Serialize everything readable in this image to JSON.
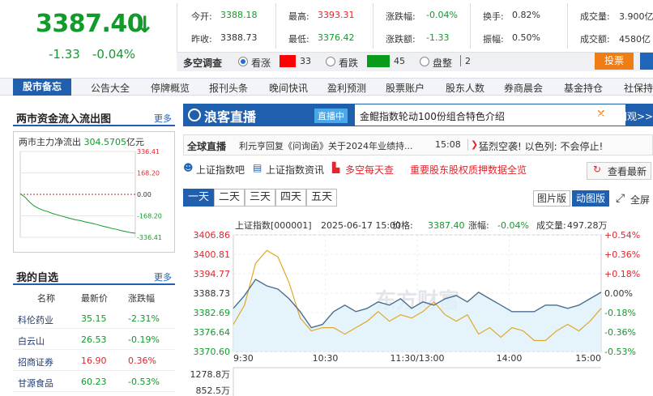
{
  "index_quote": {
    "price": "3387.40",
    "arrow": "↓",
    "change": "-1.33",
    "change_pct": "-0.04%"
  },
  "quote_stats": {
    "row1": [
      {
        "label": "今开:",
        "value": "3388.18",
        "color": "green"
      },
      {
        "label": "最高:",
        "value": "3393.31",
        "color": "red"
      },
      {
        "label": "涨跌幅:",
        "value": "-0.04%",
        "color": "green"
      },
      {
        "label": "换手:",
        "value": "0.82%",
        "color": "normal"
      },
      {
        "label": "成交量:",
        "value": "3.900亿",
        "color": "normal"
      }
    ],
    "row2": [
      {
        "label": "昨收:",
        "value": "3388.73",
        "color": "normal"
      },
      {
        "label": "最低:",
        "value": "3376.42",
        "color": "green"
      },
      {
        "label": "涨跌额:",
        "value": "-1.33",
        "color": "green"
      },
      {
        "label": "振幅:",
        "value": "0.50%",
        "color": "normal"
      },
      {
        "label": "成交额:",
        "value": "4580亿",
        "color": "normal"
      }
    ]
  },
  "poll": {
    "title": "多空调查",
    "bull_label": "看涨",
    "bull_count": "33",
    "bear_label": "看跌",
    "bear_count": "45",
    "flat_label": "盘整",
    "flat_count": "2",
    "vote_label": "投票",
    "colors": {
      "bull": "#ff0000",
      "bear": "#0a9b1a"
    }
  },
  "nav": {
    "first": "股市备忘",
    "items": [
      "公告大全",
      "停牌概览",
      "报刊头条",
      "晚间快讯",
      "盈利预测",
      "股票账户",
      "股东人数",
      "券商晨会",
      "基金持仓",
      "社保持"
    ]
  },
  "flow": {
    "title": "两市资金流入流出图",
    "more": "更多",
    "caption_prefix": "两市主力净流出",
    "caption_value": "304.5705",
    "caption_unit": "亿元",
    "y_ticks": [
      "336.41",
      "168.20",
      "0.00",
      "-168.20",
      "-336.41"
    ]
  },
  "watchlist": {
    "title": "我的自选",
    "more": "更多",
    "columns": [
      "名称",
      "最新价",
      "涨跌幅"
    ],
    "rows": [
      {
        "name": "科伦药业",
        "price": "35.15",
        "pct": "-2.31%",
        "dir": "down"
      },
      {
        "name": "白云山",
        "price": "26.53",
        "pct": "-0.19%",
        "dir": "down"
      },
      {
        "name": "招商证券",
        "price": "16.90",
        "pct": "0.36%",
        "dir": "up"
      },
      {
        "name": "甘源食品",
        "price": "60.23",
        "pct": "-0.53%",
        "dir": "down"
      }
    ]
  },
  "live": {
    "logo": "浪客直播",
    "badge": "直播中",
    "headline": "金鲲指数轮动100份组合特色介绍",
    "enter": "速来围观>>"
  },
  "global_live": {
    "label": "全球直播",
    "text": "利元亨回复《问询函》关于2024年业绩持...",
    "time": "15:08",
    "text2": "猛烈空袭! 以色列: 不会停止!"
  },
  "links": {
    "items": [
      "上证指数吧",
      "上证指数资讯",
      "多空每天查"
    ],
    "red_link": "重要股东股权质押数据全览",
    "refresh": "查看最新"
  },
  "chart_tabs": {
    "items": [
      "一天",
      "二天",
      "三天",
      "四天",
      "五天"
    ],
    "active": 0,
    "pic": "图片版",
    "dyn": "动图版",
    "full": "全屏"
  },
  "chart_header": {
    "name": "上证指数[000001]",
    "datetime": "2025-06-17 15:00",
    "price_label": "价格:",
    "price": "3387.40",
    "pct_label": "涨幅:",
    "pct": "-0.04%",
    "vol_label": "成交量:",
    "vol": "497.28万"
  },
  "watermark": "东方财富",
  "chart_data": {
    "type": "line",
    "x_ticks": [
      "9:30",
      "10:30",
      "11:30/13:00",
      "14:00",
      "15:00"
    ],
    "y_ticks_left": [
      "3406.86",
      "3400.81",
      "3394.77",
      "3388.73",
      "3382.69",
      "3376.64",
      "3370.60"
    ],
    "y_ticks_right": [
      "+0.54%",
      "+0.36%",
      "+0.18%",
      "0.00%",
      "-0.18%",
      "-0.36%",
      "-0.53%"
    ],
    "ylim": [
      3370.6,
      3406.86
    ],
    "series": [
      {
        "values": [
          3384,
          3388,
          3393,
          3391,
          3390,
          3387,
          3383,
          3378,
          3379,
          3383,
          3385,
          3383,
          3384,
          3386,
          3385,
          3387,
          3384,
          3386,
          3385,
          3387,
          3388,
          3386,
          3389,
          3387,
          3385,
          3383,
          3383,
          3383,
          3385,
          3385,
          3384,
          3385,
          3387,
          3389
        ]
      },
      {
        "values": [
          3379,
          3385,
          3398,
          3402,
          3400,
          3392,
          3381,
          3377,
          3378,
          3378,
          3376,
          3378,
          3380,
          3383,
          3380,
          3382,
          3381,
          3383,
          3386,
          3382,
          3380,
          3382,
          3376,
          3378,
          3375,
          3378,
          3377,
          3374,
          3374,
          3377,
          3379,
          3377,
          3380,
          3384
        ]
      }
    ],
    "volume_ticks": [
      "1278.8万",
      "852.5万"
    ],
    "colors": {
      "price": "#4c6e8f",
      "avg": "#e2a82a",
      "fill": "#dff0fa"
    }
  },
  "flow_chart": {
    "type": "line",
    "ylim": [
      -336.41,
      336.41
    ],
    "values": [
      5,
      -20,
      -60,
      -90,
      -110,
      -125,
      -135,
      -150,
      -160,
      -170,
      -180,
      -190,
      -200,
      -205,
      -215,
      -222,
      -230,
      -240,
      -250,
      -258,
      -268,
      -275,
      -285,
      -292,
      -300,
      -304.57
    ]
  }
}
